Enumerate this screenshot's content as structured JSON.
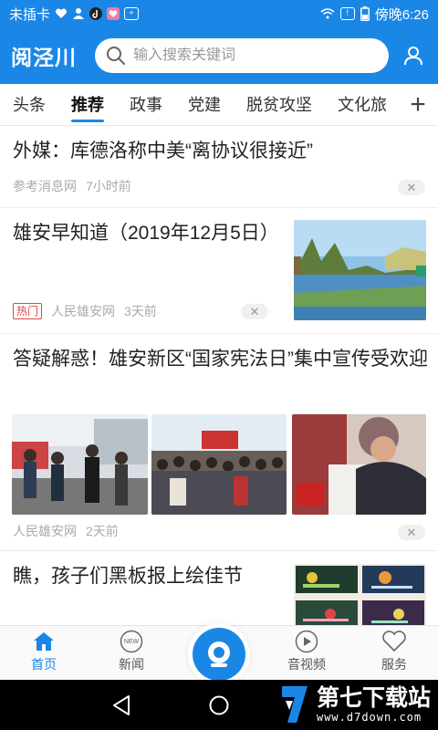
{
  "status_bar": {
    "carrier": "未插卡",
    "time": "傍晚6:26",
    "sim_badge": "!"
  },
  "header": {
    "logo": "阅泾川",
    "search_placeholder": "输入搜索关键词"
  },
  "tabs": [
    {
      "label": "头条",
      "active": false
    },
    {
      "label": "推荐",
      "active": true
    },
    {
      "label": "政事",
      "active": false
    },
    {
      "label": "党建",
      "active": false
    },
    {
      "label": "脱贫攻坚",
      "active": false
    },
    {
      "label": "文化旅",
      "active": false
    }
  ],
  "tabs_more": "+",
  "feed": [
    {
      "title": "外媒：库德洛称中美“离协议很接近”",
      "source": "参考消息网",
      "time": "7小时前"
    },
    {
      "title": "雄安早知道（2019年12月5日）",
      "tag": "热门",
      "source": "人民雄安网",
      "time": "3天前"
    },
    {
      "title": "答疑解惑！雄安新区“国家宪法日”集中宣传受欢迎",
      "source": "人民雄安网",
      "time": "2天前"
    },
    {
      "title": "瞧，孩子们黑板报上绘佳节"
    }
  ],
  "bottom_nav": [
    {
      "label": "首页",
      "icon": "home-icon",
      "active": true
    },
    {
      "label": "新闻",
      "icon": "news-icon",
      "badge": "NEW",
      "active": false
    },
    {
      "label": "音视频",
      "icon": "play-icon",
      "active": false
    },
    {
      "label": "服务",
      "icon": "heart-icon",
      "active": false
    }
  ],
  "watermark": {
    "name": "第七下载站",
    "url": "www.d7down.com"
  },
  "colors": {
    "brand": "#1a87e6",
    "hot": "#e0483e"
  }
}
